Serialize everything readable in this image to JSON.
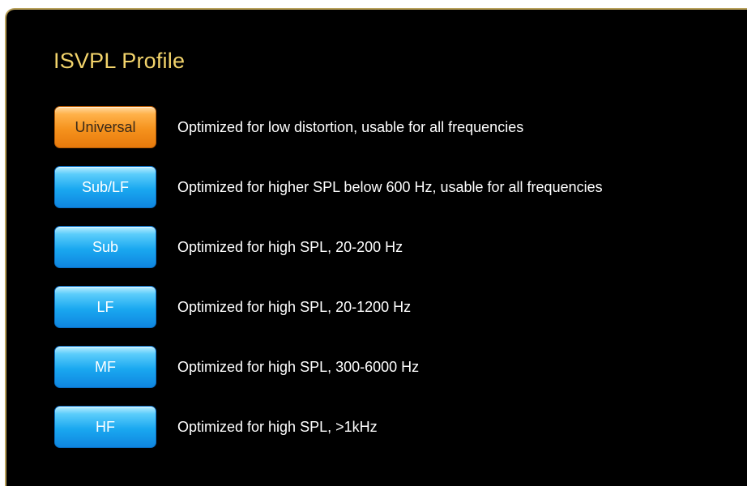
{
  "panel": {
    "title": "ISVPL Profile",
    "colors": {
      "title": "#f2d36b",
      "background": "#000000",
      "selected_button": "#f5921d",
      "button": "#1aa8f0"
    }
  },
  "profiles": [
    {
      "label": "Universal",
      "description": "Optimized for low distortion, usable for all frequencies",
      "selected": true
    },
    {
      "label": "Sub/LF",
      "description": "Optimized for higher SPL below 600 Hz, usable for all frequencies",
      "selected": false
    },
    {
      "label": "Sub",
      "description": "Optimized for high SPL, 20-200 Hz",
      "selected": false
    },
    {
      "label": "LF",
      "description": "Optimized for high SPL, 20-1200 Hz",
      "selected": false
    },
    {
      "label": "MF",
      "description": "Optimized for high SPL, 300-6000 Hz",
      "selected": false
    },
    {
      "label": "HF",
      "description": "Optimized for high SPL, >1kHz",
      "selected": false
    }
  ]
}
